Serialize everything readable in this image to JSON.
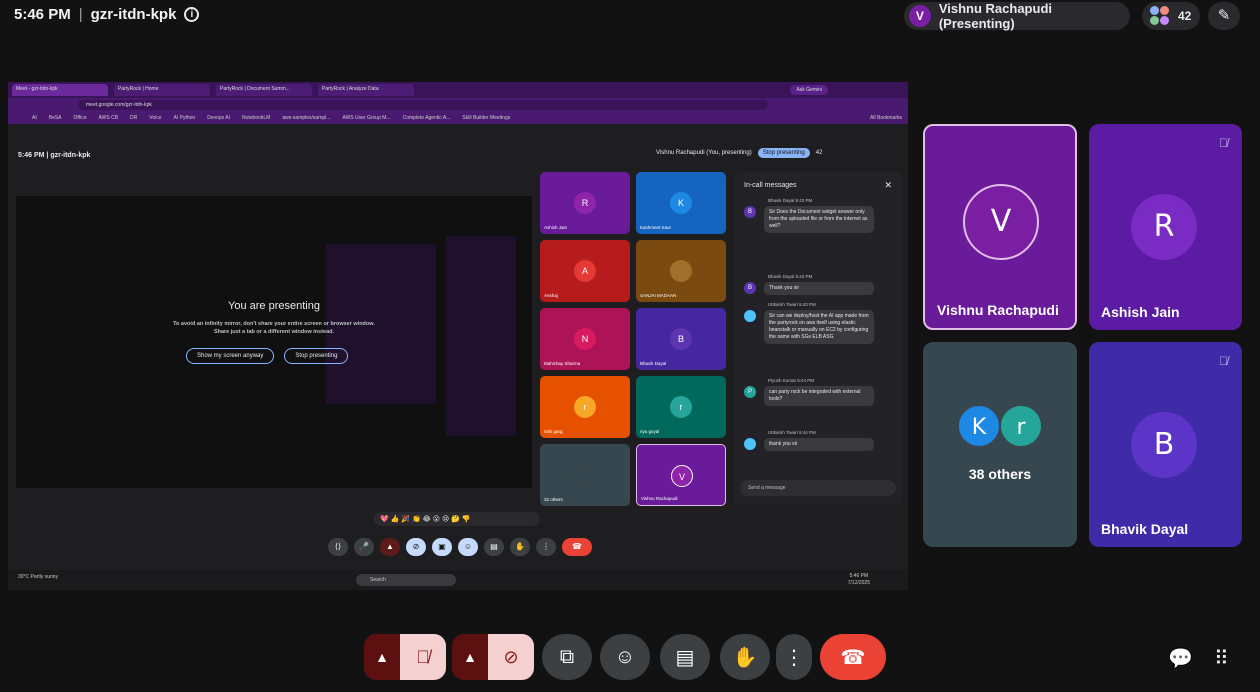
{
  "topbar": {
    "time": "5:46 PM",
    "meeting_code": "gzr-itdn-kpk",
    "presenter_initial": "V",
    "presenter_label": "Vishnu Rachapudi (Presenting)",
    "participant_count": "42"
  },
  "shared_screen": {
    "tabs": [
      "Meet - gzr-itdn-kpk",
      "PartyRock | Home",
      "PartyRock | Document Summ...",
      "PartyRock | Analyze Data"
    ],
    "ask_gemini": "Ask Gemini",
    "url": "meet.google.com/gzr-itdn-kpk",
    "bookmarks": [
      "AI",
      "BeSA",
      "Office",
      "AWS CB",
      "DR",
      "Voice",
      "AI Python",
      "Devops AI",
      "NotebookLM",
      "aws-samples/sampl...",
      "AWS User Group M...",
      "Complete Agentic A...",
      "Skill Builder Meetings",
      "All Bookmarks"
    ],
    "inner_time": "5:46 PM",
    "inner_code": "gzr-itdn-kpk",
    "inner_presenter": "Vishnu Rachapudi (You, presenting)",
    "stop_presenting": "Stop presenting",
    "inner_count": "42",
    "presenting_title": "You are presenting",
    "presenting_sub1": "To avoid an infinity mirror, don't share your entire screen or browser window.",
    "presenting_sub2": "Share just a tab or a different window instead.",
    "btn_share_anyway": "Show my screen anyway",
    "btn_stop": "Stop presenting",
    "mini_tiles": [
      {
        "initial": "R",
        "name": "Ashish Jain",
        "bg": "#6a1b9a",
        "av": "#8e24aa"
      },
      {
        "initial": "K",
        "name": "Kashmeet Kaur",
        "bg": "#1565c0",
        "av": "#1e88e5"
      },
      {
        "initial": "A",
        "name": "Anshaj",
        "bg": "#b71c1c",
        "av": "#e53935"
      },
      {
        "initial": "",
        "name": "SANJAI MADAAN",
        "bg": "#7a4a10",
        "av": "#a0702a"
      },
      {
        "initial": "N",
        "name": "Mahichay Sharma",
        "bg": "#ad1457",
        "av": "#d81b60"
      },
      {
        "initial": "B",
        "name": "Bhavik Dayal",
        "bg": "#4527a0",
        "av": "#5e35b1"
      },
      {
        "initial": "r",
        "name": "rishi garg",
        "bg": "#e65100",
        "av": "#f9a825"
      },
      {
        "initial": "r",
        "name": "riya goyal",
        "bg": "#00695c",
        "av": "#26a69a"
      },
      {
        "initial": "",
        "name": "32 others",
        "bg": "#37474f",
        "av": "#37474f"
      },
      {
        "initial": "V",
        "name": "Vishnu Rachapudi",
        "bg": "#6a1b9a",
        "av": "#8e24aa"
      }
    ],
    "chat_title": "In-call messages",
    "chat": [
      {
        "sender": "Bhavik Dayal   5:42 PM",
        "initial": "B",
        "color": "#5e35b1",
        "text": "Sir Does the Document widget answer only from the uploaded file or from the internet as well?"
      },
      {
        "sender": "Bhavik Dayal   5:43 PM",
        "initial": "B",
        "color": "#5e35b1",
        "text": "Thank you sir"
      },
      {
        "sender": "Uttkarsh Tiwari   5:43 PM",
        "initial": "",
        "color": "#4fc3f7",
        "text": "Sir can we deploy/host the AI app made from the partyrock on aws itself using elastic beanstalk or manually on EC2 by configuring the same with SGs ELB ASG"
      },
      {
        "sender": "Piyush Kumar   5:44 PM",
        "initial": "P",
        "color": "#26a69a",
        "text": "can party rock be integrated with external tools?"
      },
      {
        "sender": "Uttkarsh Tiwari   5:44 PM",
        "initial": "",
        "color": "#4fc3f7",
        "text": "thank you sir"
      }
    ],
    "chat_placeholder": "Send a message",
    "reactions": "💖 👍 🎉 👏 😂 😮 😢 🤔 👎",
    "weather": "30°C Partly sunny",
    "search": "Search",
    "clock_time": "5:46 PM",
    "clock_date": "7/12/2025"
  },
  "tiles": [
    {
      "initial": "V",
      "name": "Vishnu Rachapudi",
      "muted": false
    },
    {
      "initial": "R",
      "name": "Ashish Jain",
      "muted": true
    },
    {
      "initial_a": "K",
      "initial_b": "r",
      "name": "38 others"
    },
    {
      "initial": "B",
      "name": "Bhavik Dayal",
      "muted": true
    }
  ],
  "colors": {
    "presenter_tile": "#6a1b9a",
    "tile_purple": "#5b1ba3",
    "end_call": "#ea4335",
    "active_border": "#e1bee7"
  }
}
